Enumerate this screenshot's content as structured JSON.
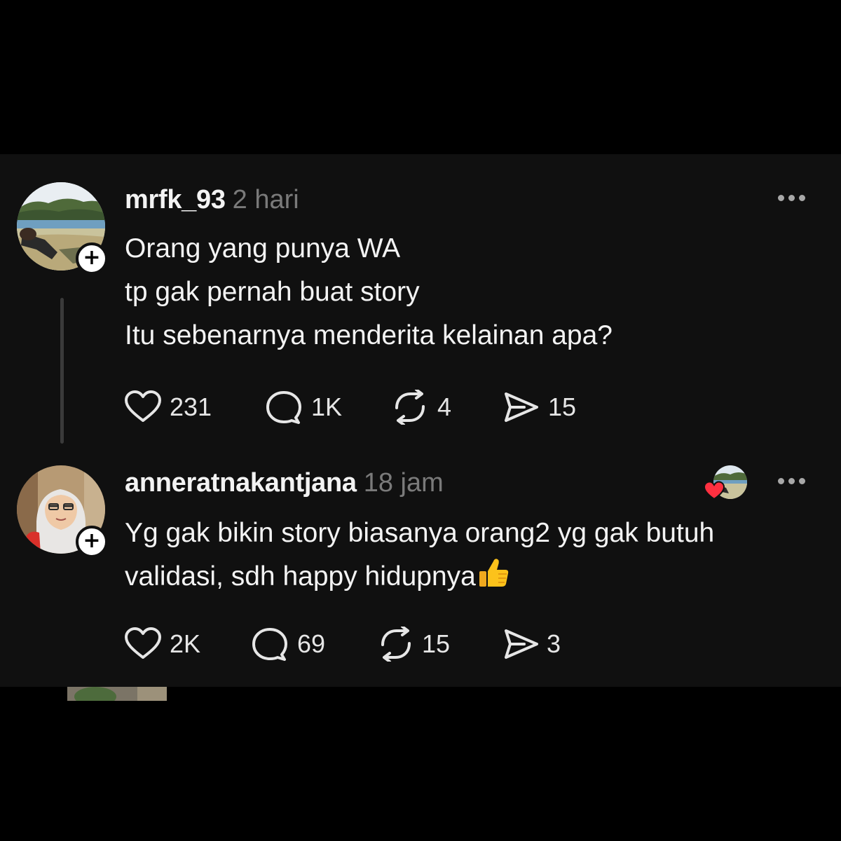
{
  "colors": {
    "background": "#000000",
    "panel": "#101010",
    "text_primary": "#f3f3f3",
    "text_secondary": "#7a7a7a",
    "icon": "#e6e6e6",
    "heart_red": "#ff3040"
  },
  "posts": [
    {
      "username": "mrfk_93",
      "time": "2 hari",
      "avatar_icon": "avatar-lake-landscape",
      "follow_badge": "+",
      "lines": [
        "Orang yang punya WA",
        "tp gak pernah buat story",
        "Itu sebenarnya menderita kelainan apa?"
      ],
      "stats": {
        "likes": "231",
        "replies": "1K",
        "reposts": "4",
        "shares": "15"
      }
    },
    {
      "username": "anneratnakantjana",
      "time": "18 jam",
      "avatar_icon": "avatar-woman-hijab",
      "follow_badge": "+",
      "liked_by_author_icon": "heart-icon",
      "lines": [
        "Yg gak bikin story biasanya orang2 yg gak butuh",
        "validasi, sdh happy hidupnya"
      ],
      "emoji": "thumbs-up-emoji",
      "stats": {
        "likes": "2K",
        "replies": "69",
        "reposts": "15",
        "shares": "3"
      }
    }
  ]
}
